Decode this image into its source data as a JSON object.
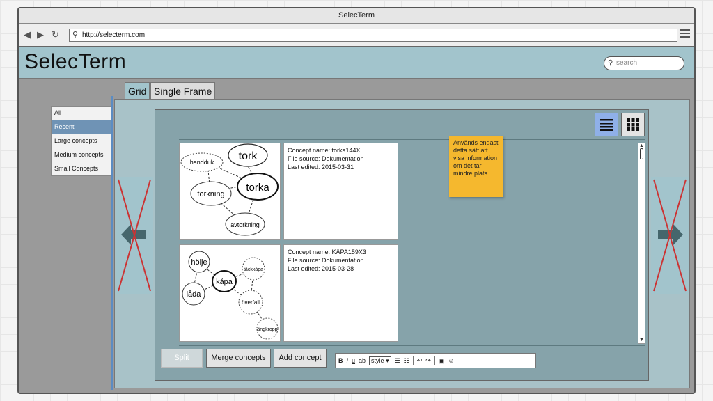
{
  "window": {
    "title": "SelecTerm"
  },
  "browser": {
    "url": "http://selecterm.com",
    "icons": [
      "back-icon",
      "forward-icon",
      "reload-icon",
      "menu-icon"
    ]
  },
  "header": {
    "logo": "SelecTerm",
    "search_placeholder": "search"
  },
  "tabs": [
    {
      "label": "Grid",
      "active": true
    },
    {
      "label": "Single Frame",
      "active": false
    }
  ],
  "sidebar": {
    "items": [
      {
        "label": "All"
      },
      {
        "label": "Recent",
        "selected": true
      },
      {
        "label": "Large concepts"
      },
      {
        "label": "Medium concepts"
      },
      {
        "label": "Small Concepts"
      }
    ]
  },
  "view_toggle": {
    "list_icon": "list-view-icon",
    "grid_icon": "grid-view-icon",
    "active": "list"
  },
  "concepts": [
    {
      "name_line": "Concept name: torka144X",
      "source_line": "File source: Dokumentation",
      "edited_line": "Last edited: 2015-03-31",
      "map": {
        "center": "torka",
        "nodes": [
          "tork",
          "handduk",
          "torkning",
          "avtorkning"
        ]
      }
    },
    {
      "name_line": "Concept name: KÅPA159X3",
      "source_line": "File source: Dokumentation",
      "edited_line": "Last edited: 2015-03-28",
      "map": {
        "center": "kåpa",
        "nodes": [
          "hölje",
          "täckkåpa",
          "låda",
          "överfall",
          "ängkropp"
        ]
      }
    }
  ],
  "sticky_note": "Används endast detta sätt att visa information om det tar mindre plats",
  "actions": {
    "split": "Split",
    "merge": "Merge concepts",
    "add": "Add concept"
  },
  "editor": {
    "bold": "B",
    "italic": "I",
    "underline": "u",
    "strike": "ab",
    "style": "style"
  },
  "colors": {
    "header_bg": "#a2c4cc",
    "selected_item": "#6f93b5",
    "sticky": "#f5b82e",
    "cross": "#cc3333"
  }
}
